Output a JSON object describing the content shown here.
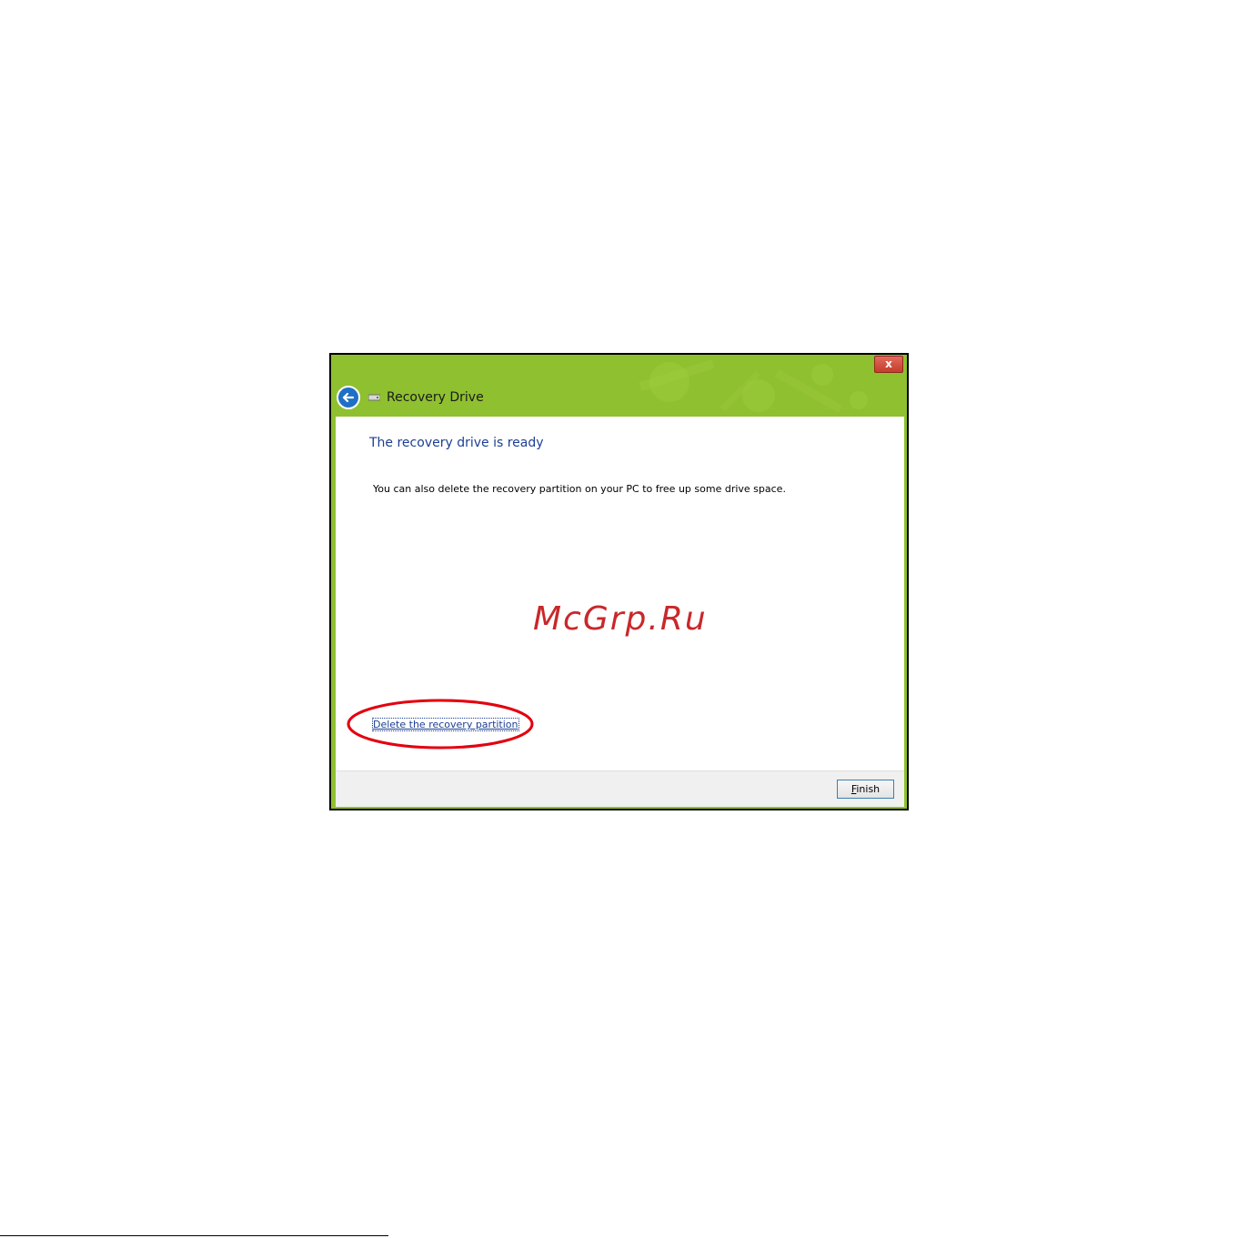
{
  "window": {
    "title": "Recovery Drive",
    "close_label": "x"
  },
  "content": {
    "heading": "The recovery drive is ready",
    "description": "You can also delete the recovery partition on your PC to free up some drive space.",
    "delete_link": "Delete the recovery partition"
  },
  "watermark": "McGrp.Ru",
  "footer": {
    "finish_label_mnemonic": "F",
    "finish_label_rest": "inish"
  },
  "colors": {
    "title_bar": "#8fc02f",
    "heading": "#1c3f94",
    "link": "#1c3f94",
    "highlight_ellipse": "#e3000f",
    "watermark": "#c8282b",
    "back_button": "#1f6fc4"
  },
  "icons": {
    "back": "back-arrow-icon",
    "drive": "usb-drive-icon",
    "close": "close-icon"
  }
}
